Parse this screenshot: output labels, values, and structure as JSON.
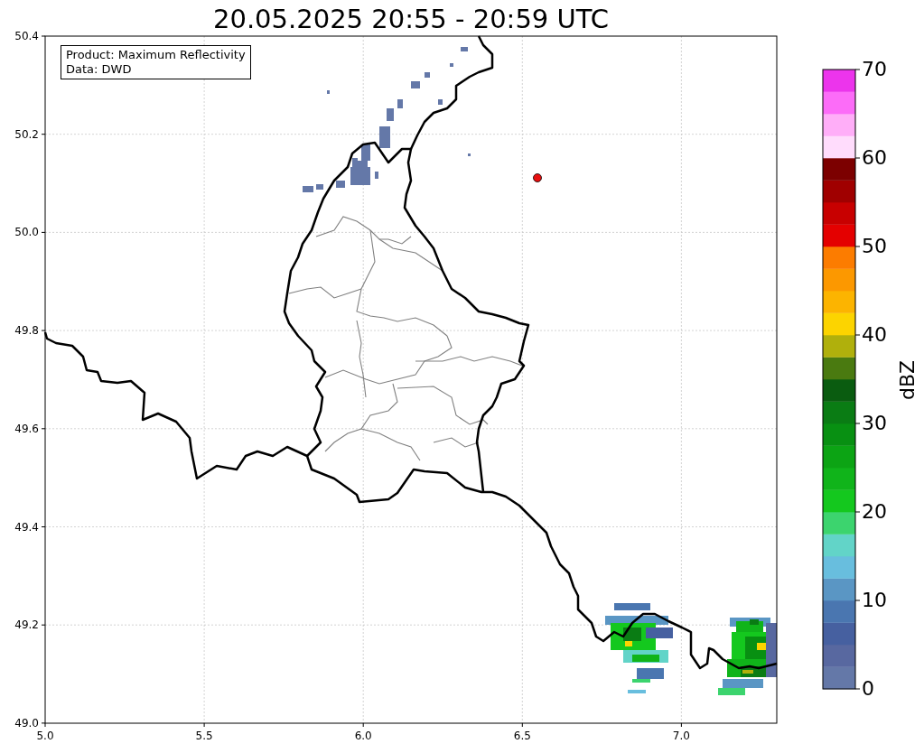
{
  "title": "20.05.2025 20:55 - 20:59 UTC",
  "info_box": [
    "Product: Maximum Reflectivity",
    "Data: DWD"
  ],
  "x_ticks": [
    "5.0",
    "5.5",
    "6.0",
    "6.5",
    "7.0"
  ],
  "y_ticks": [
    "50.4",
    "50.2",
    "50.0",
    "49.8",
    "49.6",
    "49.4",
    "49.2",
    "49.0"
  ],
  "colorbar": {
    "label": "dBZ",
    "ticks": [
      "70",
      "60",
      "50",
      "40",
      "30",
      "20",
      "10",
      "0"
    ],
    "segments": [
      {
        "color": "#6478a8"
      },
      {
        "color": "#5868a0"
      },
      {
        "color": "#4660a0"
      },
      {
        "color": "#4a76b0"
      },
      {
        "color": "#5a96c4"
      },
      {
        "color": "#68bede"
      },
      {
        "color": "#62d4c8"
      },
      {
        "color": "#3cd46e"
      },
      {
        "color": "#14c81e"
      },
      {
        "color": "#10b41a"
      },
      {
        "color": "#0ca414"
      },
      {
        "color": "#089012"
      },
      {
        "color": "#0a7c14"
      },
      {
        "color": "#0a5c10"
      },
      {
        "color": "#4a7a10"
      },
      {
        "color": "#b0b00c"
      },
      {
        "color": "#fcd400"
      },
      {
        "color": "#fcb400"
      },
      {
        "color": "#fc9800"
      },
      {
        "color": "#fc7c00"
      },
      {
        "color": "#e40000"
      },
      {
        "color": "#c80000"
      },
      {
        "color": "#a00000"
      },
      {
        "color": "#7c0000"
      },
      {
        "color": "#ffdcfc"
      },
      {
        "color": "#ffaef8"
      },
      {
        "color": "#fc6cf8"
      },
      {
        "color": "#ec34ec"
      }
    ]
  }
}
